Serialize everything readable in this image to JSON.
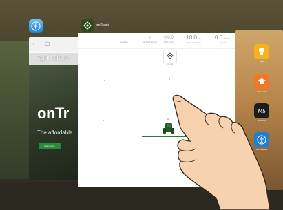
{
  "switcher": {
    "safari": {
      "site_logo": "AgriCulture",
      "hero_title": "onTr",
      "hero_subtitle": "The affordable",
      "cta_label": "Learn more"
    },
    "ontrack": {
      "app_name": "onTrack",
      "stats": [
        {
          "value": "",
          "unit": "",
          "label": "Accuracy"
        },
        {
          "value": "",
          "unit": "",
          "label": "onTrack device"
        },
        {
          "value": "0.0.0",
          "unit": "",
          "label": "GPS signal"
        },
        {
          "value": "10.0",
          "unit": "m",
          "label": "Implement width"
        },
        {
          "value": "0.0",
          "unit": "km/h",
          "label": "Speed"
        }
      ],
      "center_button_label": "Center"
    },
    "home_screen": {
      "apps": [
        {
          "name": "Tips",
          "icon": "lightbulb-icon",
          "color": "#f5b21e"
        },
        {
          "name": "iTunes U",
          "icon": "graduation-cap-icon",
          "color": "#f0782a"
        },
        {
          "name": "MyScript",
          "icon": "myscript-icon",
          "color": "#1c1c1e"
        },
        {
          "name": "Accessibility",
          "icon": "accessibility-icon",
          "color": "#1f7fd6"
        }
      ]
    }
  },
  "colors": {
    "track_line": "#2e7d32",
    "tractor": "#1f5b22",
    "cta": "#2a8a3c"
  }
}
